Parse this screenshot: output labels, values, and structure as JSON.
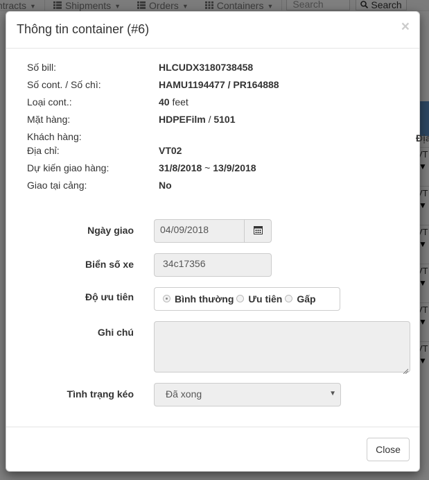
{
  "nav": {
    "items": [
      {
        "label": "ntracts",
        "icon": ""
      },
      {
        "label": "Shipments",
        "icon": "list-icon"
      },
      {
        "label": "Orders",
        "icon": "list-icon"
      },
      {
        "label": "Containers",
        "icon": "grid-icon"
      }
    ],
    "search_placeholder": "Search",
    "search_button": "Search"
  },
  "background_table": {
    "header": "Địa",
    "row_text": "VT"
  },
  "modal": {
    "title": "Thông tin container (#6)",
    "close_x": "×",
    "info": [
      {
        "label": "Số bill:",
        "value": "HLCUDX3180738458"
      },
      {
        "label": "Số cont. / Số chì:",
        "value": "HAMU1194477 / PR164888"
      },
      {
        "label": "Loại cont.:",
        "value_bold": "40",
        "value_normal": " feet"
      },
      {
        "label": "Mặt hàng:",
        "value_bold": "HDPEFilm",
        "value_normal": " / ",
        "value_bold2": "5101"
      },
      {
        "label": "Khách hàng:",
        "value": ""
      },
      {
        "label": "Địa chỉ:",
        "value": "VT02"
      },
      {
        "label": "Dự kiến giao hàng:",
        "value_bold": "31/8/2018",
        "value_normal": " ~ ",
        "value_bold2": "13/9/2018"
      },
      {
        "label": "Giao tại cảng:",
        "value": "No"
      }
    ],
    "form": {
      "delivery_date_label": "Ngày giao",
      "delivery_date_value": "04/09/2018",
      "plate_label": "Biển số xe",
      "plate_value": "34c17356",
      "priority_label": "Độ ưu tiên",
      "priority_options": [
        "Bình thường",
        "Ưu tiên",
        "Gấp"
      ],
      "priority_selected": "Bình thường",
      "note_label": "Ghi chú",
      "note_value": "",
      "status_label": "Tình trạng kéo",
      "status_value": "Đã xong"
    },
    "footer": {
      "close_label": "Close"
    }
  }
}
